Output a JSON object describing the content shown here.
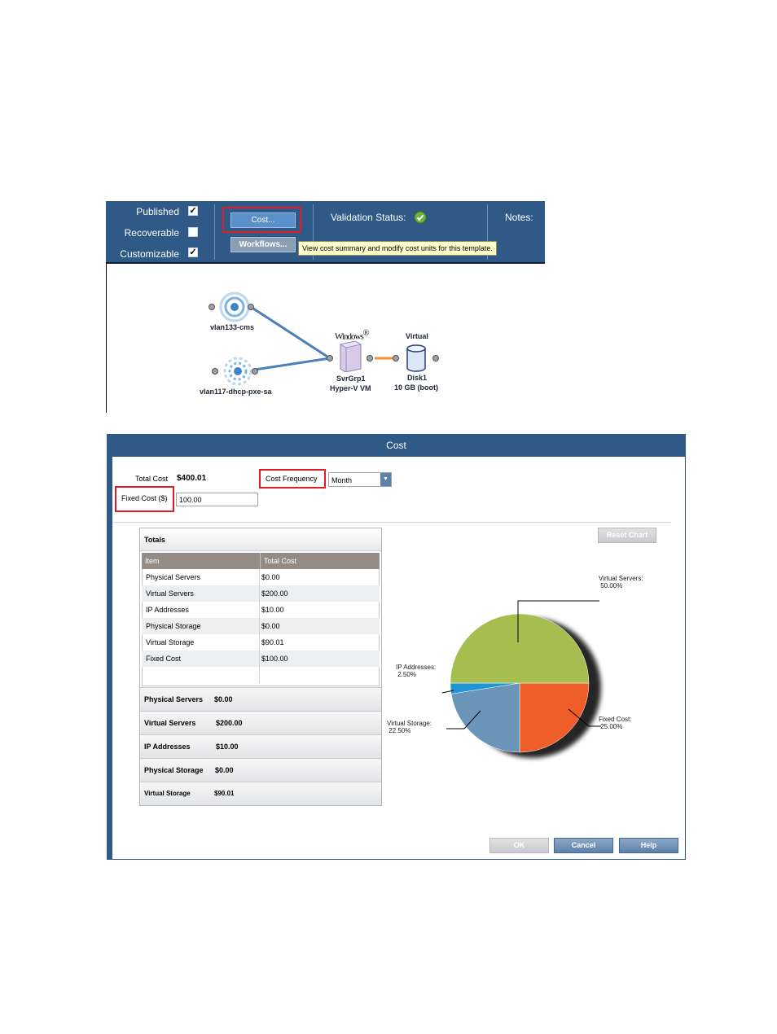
{
  "template_header": {
    "published_label": "Published",
    "published_checked": true,
    "recoverable_label": "Recoverable",
    "recoverable_checked": false,
    "customizable_label": "Customizable",
    "customizable_checked": true,
    "cost_button_label": "Cost...",
    "workflows_button_label": "Workflows...",
    "tooltip": "View cost summary and modify cost units for this template.",
    "validation_label": "Validation Status:",
    "validation_state": "valid",
    "notes_label": "Notes:",
    "check_mark": "✓"
  },
  "diagram": {
    "networks": [
      {
        "name": "vlan133-cms",
        "icon": "network-icon"
      },
      {
        "name": "vlan117-dhcp-pxe-sa",
        "icon": "network-dhcp-icon"
      }
    ],
    "server_group": {
      "os_logo": "Windows",
      "registered": "®",
      "name": "SvrGrp1",
      "type": "Hyper-V VM",
      "icon": "server-icon"
    },
    "disk": {
      "top_label": "Virtual",
      "name": "Disk1",
      "size": "10 GB (boot)",
      "icon": "disk-icon"
    },
    "colors": {
      "link": "#4a82b8",
      "storage_link": "#f0962e"
    }
  },
  "cost_dialog": {
    "title": "Cost",
    "total_cost_label": "Total Cost",
    "total_cost_value": "$400.01",
    "cost_frequency_label": "Cost Frequency",
    "cost_frequency_value": "Month",
    "fixed_cost_label": "Fixed Cost ($)",
    "fixed_cost_value": "100.00",
    "reset_chart_label": "Reset Chart",
    "totals_title": "Totals",
    "columns": [
      "Item",
      "Total Cost"
    ],
    "rows": [
      {
        "item": "Physical Servers",
        "cost": "$0.00"
      },
      {
        "item": "Virtual Servers",
        "cost": "$200.00"
      },
      {
        "item": "IP Addresses",
        "cost": "$10.00"
      },
      {
        "item": "Physical Storage",
        "cost": "$0.00"
      },
      {
        "item": "Virtual Storage",
        "cost": "$90.01"
      },
      {
        "item": "Fixed Cost",
        "cost": "$100.00"
      }
    ],
    "summary": [
      {
        "label": "Physical Servers",
        "value": "$0.00"
      },
      {
        "label": "Virtual Servers",
        "value": "$200.00"
      },
      {
        "label": "IP Addresses",
        "value": "$10.00"
      },
      {
        "label": "Physical Storage",
        "value": "$0.00"
      },
      {
        "label": "Virtual Storage",
        "value": "$90.01"
      }
    ],
    "ok_label": "OK",
    "cancel_label": "Cancel",
    "help_label": "Help",
    "dropdown_arrow": "▼"
  },
  "chart_data": {
    "type": "pie",
    "slices": [
      {
        "label": "Virtual Servers:",
        "percent_text": "50.00%",
        "value": 50.0,
        "color": "#a6be4f"
      },
      {
        "label": "Fixed Cost:",
        "percent_text": "25.00%",
        "value": 25.0,
        "color": "#ef5d28"
      },
      {
        "label": "Virtual Storage:",
        "percent_text": "22.50%",
        "value": 22.5,
        "color": "#6a95b8"
      },
      {
        "label": "IP Addresses:",
        "percent_text": "2.50%",
        "value": 2.5,
        "color": "#1f95d6"
      }
    ],
    "start_angle": "3 o'clock, clockwise"
  }
}
